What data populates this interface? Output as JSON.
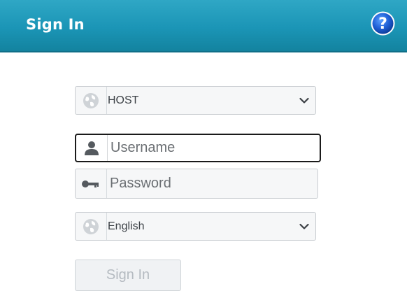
{
  "header": {
    "title": "Sign In",
    "help_icon": "help-question-icon",
    "color": "#1b95b6"
  },
  "form": {
    "host_select": {
      "value": "HOST",
      "icon": "globe-icon"
    },
    "username": {
      "placeholder": "Username",
      "value": "",
      "icon": "user-icon"
    },
    "password": {
      "placeholder": "Password",
      "value": "",
      "icon": "key-icon"
    },
    "language_select": {
      "value": "English",
      "icon": "globe-icon"
    },
    "submit_label": "Sign In",
    "submit_disabled": true
  }
}
